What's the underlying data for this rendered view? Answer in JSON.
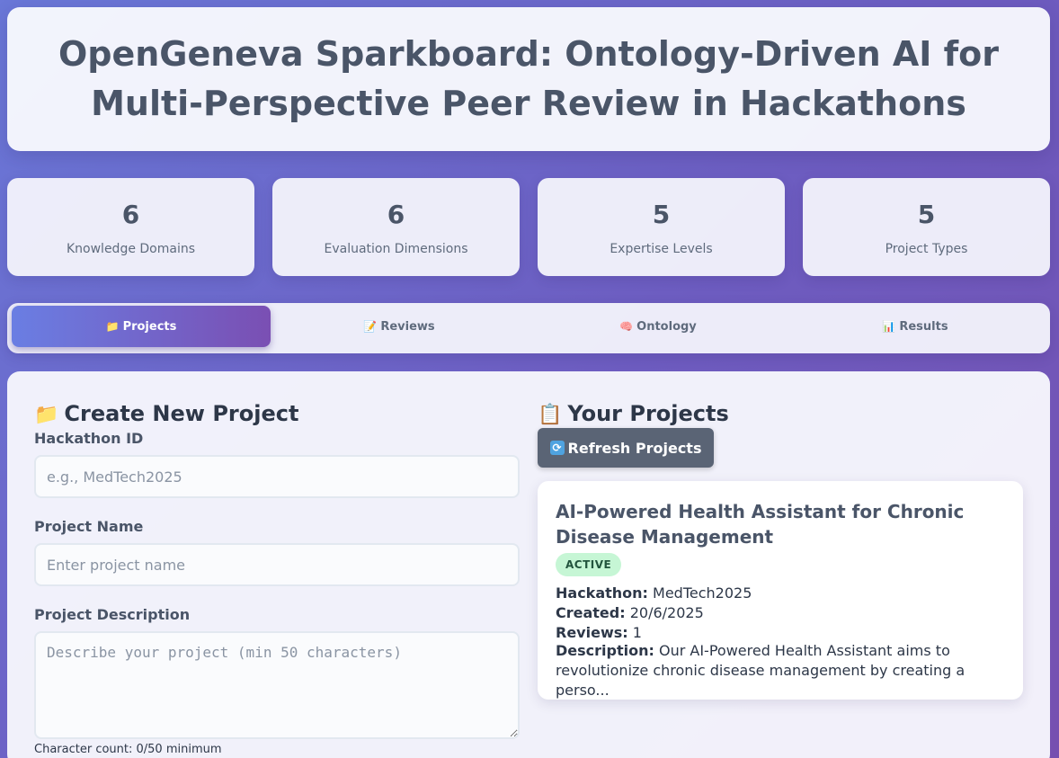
{
  "header": {
    "title": "OpenGeneva Sparkboard: Ontology-Driven AI for Multi-Perspective Peer Review in Hackathons"
  },
  "stats": [
    {
      "value": "6",
      "label": "Knowledge Domains"
    },
    {
      "value": "6",
      "label": "Evaluation Dimensions"
    },
    {
      "value": "5",
      "label": "Expertise Levels"
    },
    {
      "value": "5",
      "label": "Project Types"
    }
  ],
  "tabs": [
    {
      "icon": "📁",
      "label": "Projects",
      "active": true
    },
    {
      "icon": "📝",
      "label": "Reviews",
      "active": false
    },
    {
      "icon": "🧠",
      "label": "Ontology",
      "active": false
    },
    {
      "icon": "📊",
      "label": "Results",
      "active": false
    }
  ],
  "create_form": {
    "icon": "📁",
    "title": "Create New Project",
    "hackathon_label": "Hackathon ID",
    "hackathon_placeholder": "e.g., MedTech2025",
    "name_label": "Project Name",
    "name_placeholder": "Enter project name",
    "description_label": "Project Description",
    "description_placeholder": "Describe your project (min 50 characters)",
    "char_count": "Character count: 0/50 minimum"
  },
  "projects_panel": {
    "icon": "📋",
    "title": "Your Projects",
    "refresh_label": "Refresh Projects",
    "projects": [
      {
        "name": "AI-Powered Health Assistant for Chronic Disease Management",
        "status": "ACTIVE",
        "hackathon_label": "Hackathon:",
        "hackathon": "MedTech2025",
        "created_label": "Created:",
        "created": "20/6/2025",
        "reviews_label": "Reviews:",
        "reviews": "1",
        "description_label": "Description:",
        "description": "Our AI-Powered Health Assistant aims to revolutionize chronic disease management by creating a perso..."
      }
    ]
  },
  "colors": {
    "accent_gradient_start": "#6a7ee3",
    "accent_gradient_end": "#7a4fb3",
    "status_active_bg": "#c6f6d5",
    "status_active_text": "#22543d",
    "refresh_button_bg": "#5a6475"
  }
}
